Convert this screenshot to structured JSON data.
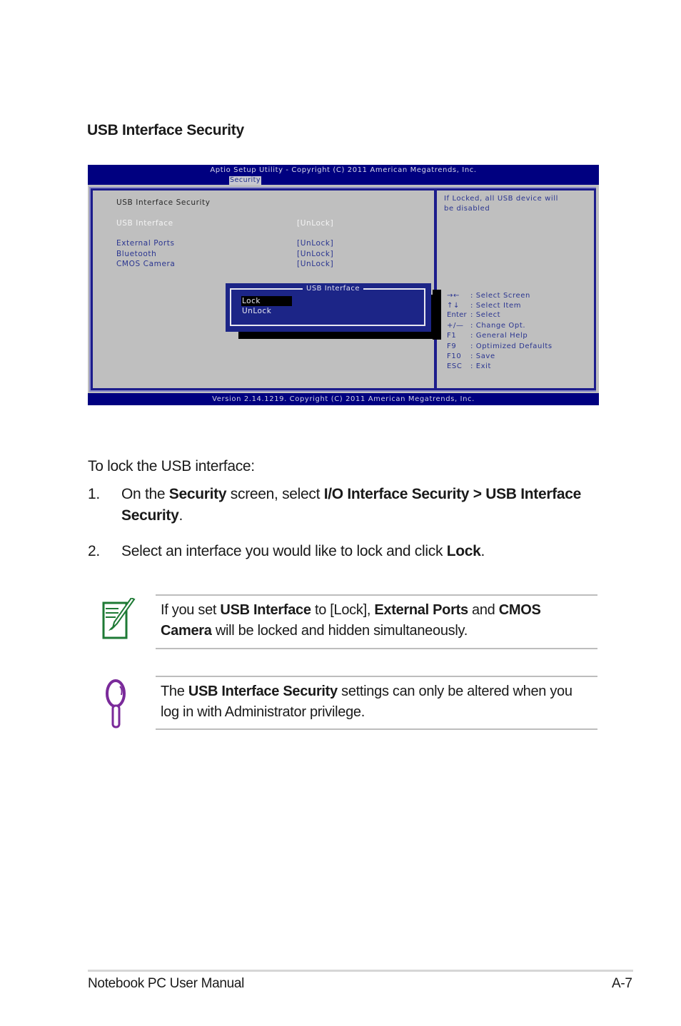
{
  "section_title": "USB Interface Security",
  "bios": {
    "header_title": "Aptio Setup Utility - Copyright (C) 2011 American Megatrends, Inc.",
    "active_tab": "Security",
    "panel_title": "USB Interface Security",
    "settings": [
      {
        "label": "USB Interface",
        "value": "[UnLock]"
      },
      {
        "label": "External Ports",
        "value": "[UnLock]"
      },
      {
        "label": "Bluetooth",
        "value": "[UnLock]"
      },
      {
        "label": "CMOS Camera",
        "value": "[UnLock]"
      }
    ],
    "help_text": [
      "If Locked, all USB device will",
      "be disabled"
    ],
    "popup": {
      "title": "USB Interface",
      "options": [
        "Lock",
        "UnLock"
      ],
      "selected": "Lock"
    },
    "key_help": [
      {
        "key": "→←",
        "action": ": Select Screen"
      },
      {
        "key": "↑↓",
        "action": ": Select Item"
      },
      {
        "key": "Enter",
        "action": ": Select"
      },
      {
        "key": "+/—",
        "action": ": Change Opt."
      },
      {
        "key": "F1",
        "action": ": General Help"
      },
      {
        "key": "F9",
        "action": ": Optimized Defaults"
      },
      {
        "key": "F10",
        "action": ": Save"
      },
      {
        "key": "ESC",
        "action": ": Exit"
      }
    ],
    "footer": "Version 2.14.1219. Copyright (C) 2011 American Megatrends, Inc.",
    "colors": {
      "header_bg": "#000080",
      "body_bg": "#bfbfbf",
      "popup_bg": "#1c2587",
      "text_blue": "#2a3590"
    }
  },
  "instructions": {
    "intro": "To lock the USB interface:",
    "steps": [
      {
        "num": "1.",
        "parts": [
          "On the ",
          "Security",
          " screen, select ",
          "I/O Interface Security > USB Interface Security",
          "."
        ]
      },
      {
        "num": "2.",
        "parts": [
          "Select an interface you would like to lock and click ",
          "Lock",
          "."
        ]
      }
    ]
  },
  "notes": [
    {
      "icon": "note-pencil-icon",
      "parts": [
        "If you set ",
        "USB Interface",
        " to [Lock], ",
        "External Ports",
        " and ",
        "CMOS Camera",
        " will be locked and hidden simultaneously."
      ],
      "icon_color": "#1e7a35"
    },
    {
      "icon": "magnifier-tip-icon",
      "parts": [
        "The ",
        "USB Interface Security",
        " settings can only be altered when you log in with Administrator privilege."
      ],
      "icon_color": "#7a2a9a"
    }
  ],
  "footer": {
    "left": "Notebook PC User Manual",
    "right": "A-7"
  }
}
